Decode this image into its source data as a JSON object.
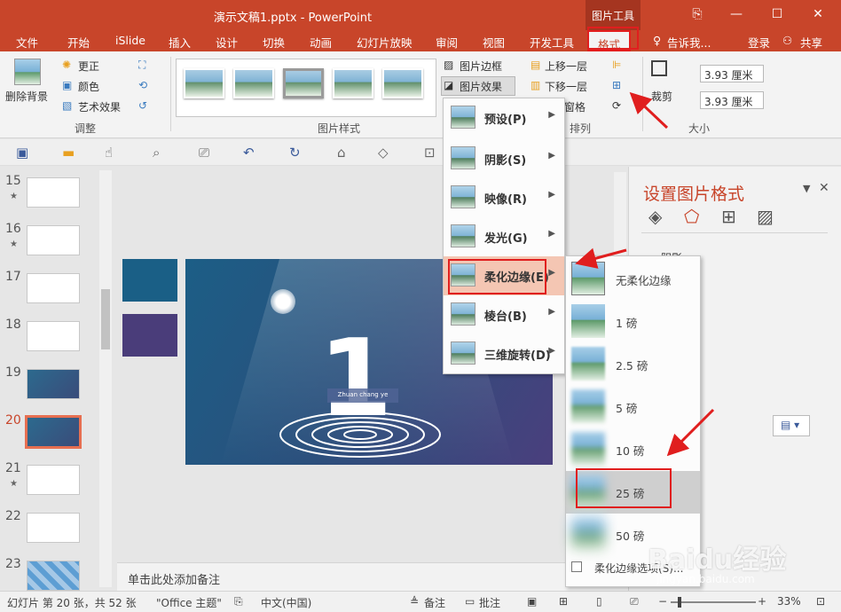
{
  "window": {
    "title": "演示文稿1.pptx - PowerPoint",
    "context_tab_group": "图片工具",
    "controls": [
      "⎘",
      "—",
      "☐",
      "✕"
    ]
  },
  "tabs": [
    "文件",
    "开始",
    "iSlide",
    "插入",
    "设计",
    "切换",
    "动画",
    "幻灯片放映",
    "审阅",
    "视图",
    "开发工具",
    "格式"
  ],
  "active_tab": "格式",
  "tell_me": "告诉我...",
  "login": "登录",
  "share": "共享",
  "ribbon": {
    "remove_bg": "删除背景",
    "correct": "更正",
    "color": "颜色",
    "art_effect": "艺术效果",
    "adjust_group": "调整",
    "styles_group": "图片样式",
    "border": "图片边框",
    "effects": "图片效果",
    "bring_forward": "上移一层",
    "send_backward": "下移一层",
    "selection_pane": "窗格",
    "arrange_group": "排列",
    "crop": "裁剪",
    "height": "3.93 厘米",
    "width": "3.93 厘米",
    "size_group": "大小"
  },
  "slides": [
    {
      "num": "15",
      "star": "★"
    },
    {
      "num": "16",
      "star": "★"
    },
    {
      "num": "17",
      "star": ""
    },
    {
      "num": "18",
      "star": ""
    },
    {
      "num": "19",
      "star": ""
    },
    {
      "num": "20",
      "star": ""
    },
    {
      "num": "21",
      "star": "★"
    },
    {
      "num": "22",
      "star": ""
    },
    {
      "num": "23",
      "star": ""
    }
  ],
  "slide": {
    "big_number": "1",
    "caption": "Zhuan chang ye"
  },
  "notes_placeholder": "单击此处添加备注",
  "pane": {
    "title": "设置图片格式",
    "section": "阴影"
  },
  "effects_menu": [
    {
      "label": "预设(P)"
    },
    {
      "label": "阴影(S)"
    },
    {
      "label": "映像(R)"
    },
    {
      "label": "发光(G)"
    },
    {
      "label": "柔化边缘(E)"
    },
    {
      "label": "棱台(B)"
    },
    {
      "label": "三维旋转(D)"
    }
  ],
  "soft_edges_menu": [
    {
      "label": "无柔化边缘"
    },
    {
      "label": "1 磅"
    },
    {
      "label": "2.5 磅"
    },
    {
      "label": "5 磅"
    },
    {
      "label": "10 磅"
    },
    {
      "label": "25 磅"
    },
    {
      "label": "50 磅"
    }
  ],
  "soft_edges_options": "柔化边缘选项(S)...",
  "status": {
    "slide_info": "幻灯片 第 20 张，共 52 张",
    "theme": "\"Office 主题\"",
    "language": "中文(中国)",
    "notes": "备注",
    "comments": "批注",
    "zoom": "33%"
  },
  "watermark": {
    "brand": "Baidu经验",
    "url": "jingyan.baidu.com"
  }
}
